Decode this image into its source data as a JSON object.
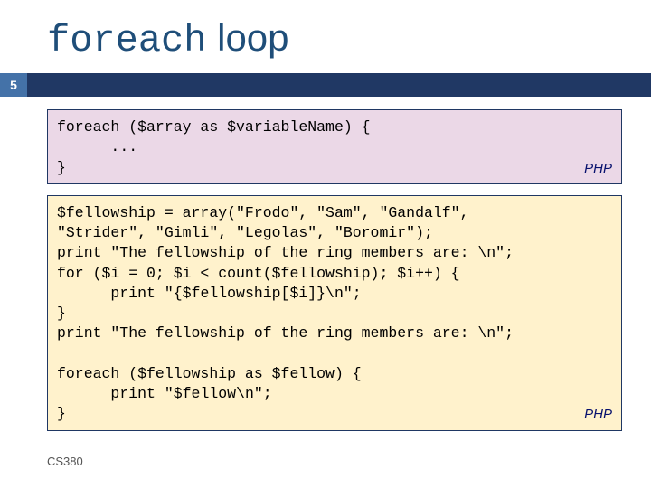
{
  "title": {
    "mono": "foreach",
    "rest": " loop"
  },
  "pageNumber": "5",
  "box1": {
    "code": "foreach ($array as $variableName) {\n      ...\n}",
    "lang": "PHP"
  },
  "box2": {
    "code": "$fellowship = array(\"Frodo\", \"Sam\", \"Gandalf\",\n\"Strider\", \"Gimli\", \"Legolas\", \"Boromir\");\nprint \"The fellowship of the ring members are: \\n\";\nfor ($i = 0; $i < count($fellowship); $i++) {\n      print \"{$fellowship[$i]}\\n\";\n}\nprint \"The fellowship of the ring members are: \\n\";\n\nforeach ($fellowship as $fellow) {\n      print \"$fellow\\n\";\n}",
    "lang": "PHP"
  },
  "footer": "CS380"
}
